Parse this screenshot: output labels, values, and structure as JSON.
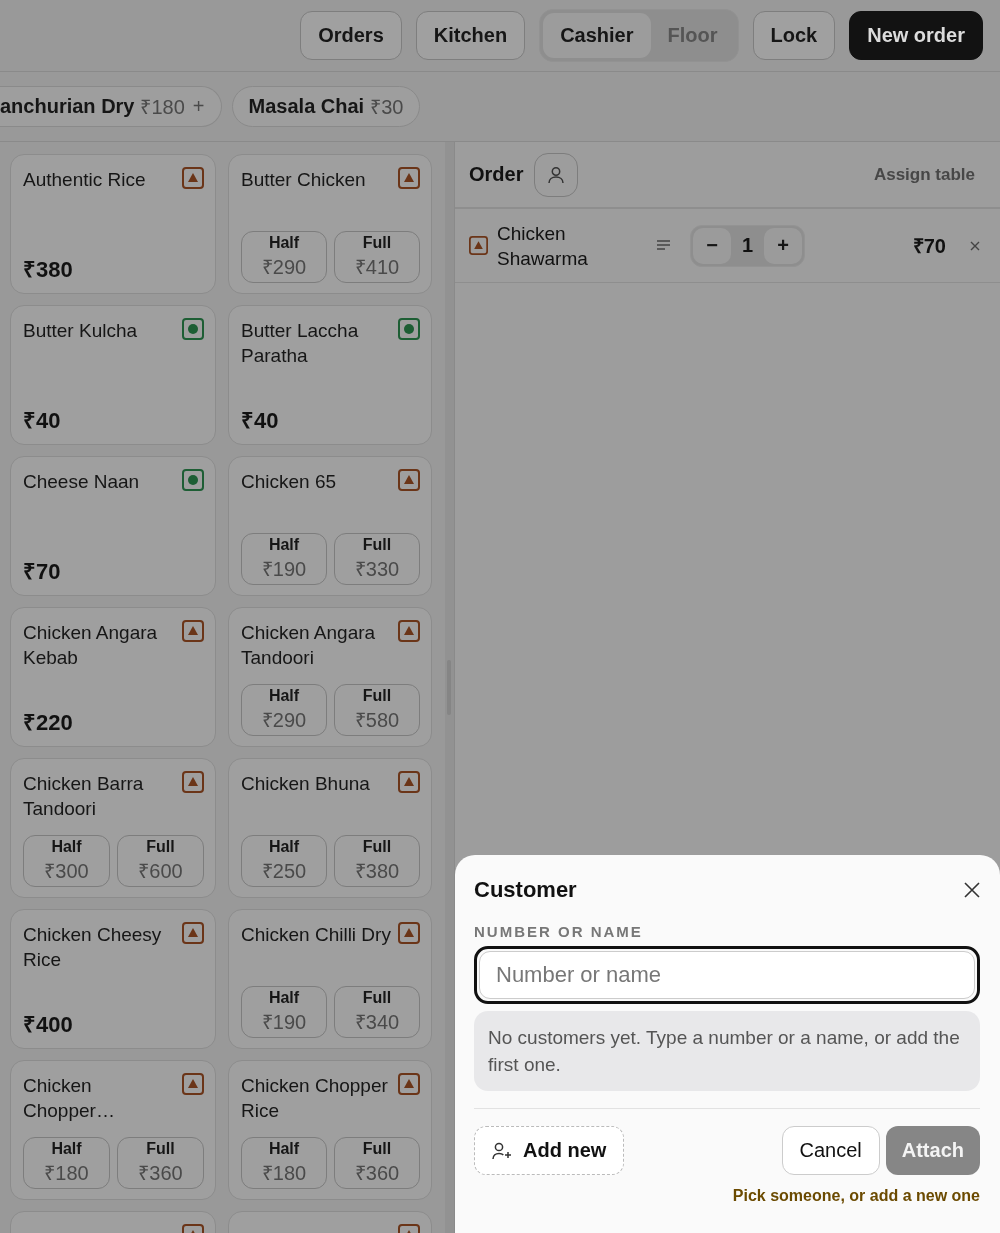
{
  "top_bar": {
    "buttons": [
      "Orders",
      "Kitchen"
    ],
    "mode_tabs": [
      {
        "label": "Cashier",
        "selected": true
      },
      {
        "label": "Floor",
        "selected": false
      }
    ],
    "lock": "Lock",
    "new_order": "New order"
  },
  "quick_items": [
    {
      "name": "anchurian Dry",
      "price": "₹180",
      "add": "+"
    },
    {
      "name": "Masala Chai",
      "price": "₹30"
    }
  ],
  "menu": [
    {
      "name": "Authentic Rice",
      "kind": "nonveg",
      "price": "₹380"
    },
    {
      "name": "Butter Chicken",
      "kind": "nonveg",
      "variants": [
        {
          "label": "Half",
          "price": "₹290"
        },
        {
          "label": "Full",
          "price": "₹410"
        }
      ]
    },
    {
      "name": "Butter Kulcha",
      "kind": "veg",
      "price": "₹40"
    },
    {
      "name": "Butter Laccha Paratha",
      "kind": "veg",
      "price": "₹40"
    },
    {
      "name": "Cheese Naan",
      "kind": "veg",
      "price": "₹70"
    },
    {
      "name": "Chicken 65",
      "kind": "nonveg",
      "variants": [
        {
          "label": "Half",
          "price": "₹190"
        },
        {
          "label": "Full",
          "price": "₹330"
        }
      ]
    },
    {
      "name": "Chicken Angara Kebab",
      "kind": "nonveg",
      "price": "₹220"
    },
    {
      "name": "Chicken Angara Tandoori",
      "kind": "nonveg",
      "variants": [
        {
          "label": "Half",
          "price": "₹290"
        },
        {
          "label": "Full",
          "price": "₹580"
        }
      ]
    },
    {
      "name": "Chicken Barra Tandoori",
      "kind": "nonveg",
      "variants": [
        {
          "label": "Half",
          "price": "₹300"
        },
        {
          "label": "Full",
          "price": "₹600"
        }
      ]
    },
    {
      "name": "Chicken Bhuna",
      "kind": "nonveg",
      "variants": [
        {
          "label": "Half",
          "price": "₹250"
        },
        {
          "label": "Full",
          "price": "₹380"
        }
      ]
    },
    {
      "name": "Chicken Cheesy Rice",
      "kind": "nonveg",
      "price": "₹400"
    },
    {
      "name": "Chicken Chilli Dry",
      "kind": "nonveg",
      "variants": [
        {
          "label": "Half",
          "price": "₹190"
        },
        {
          "label": "Full",
          "price": "₹340"
        }
      ]
    },
    {
      "name": "Chicken Chopper…",
      "kind": "nonveg",
      "variants": [
        {
          "label": "Half",
          "price": "₹180"
        },
        {
          "label": "Full",
          "price": "₹360"
        }
      ]
    },
    {
      "name": "Chicken Chopper Rice",
      "kind": "nonveg",
      "variants": [
        {
          "label": "Half",
          "price": "₹180"
        },
        {
          "label": "Full",
          "price": "₹360"
        }
      ]
    },
    {
      "kind": "nonveg"
    },
    {
      "kind": "nonveg"
    }
  ],
  "order": {
    "title": "Order",
    "assign_table": "Assign table",
    "lines": [
      {
        "name": "Chicken Shawarma",
        "kind": "nonveg",
        "minus": "−",
        "quantity": "1",
        "plus": "+",
        "price": "₹70"
      }
    ]
  },
  "customer_sheet": {
    "title": "Customer",
    "field_label": "NUMBER OR NAME",
    "placeholder": "Number or name",
    "empty_message": "No customers yet. Type a number or a name, or add the first one.",
    "add_new": "Add new",
    "cancel": "Cancel",
    "attach": {
      "label": "Attach",
      "disabled": true
    },
    "hint": "Pick someone, or add a new one"
  }
}
